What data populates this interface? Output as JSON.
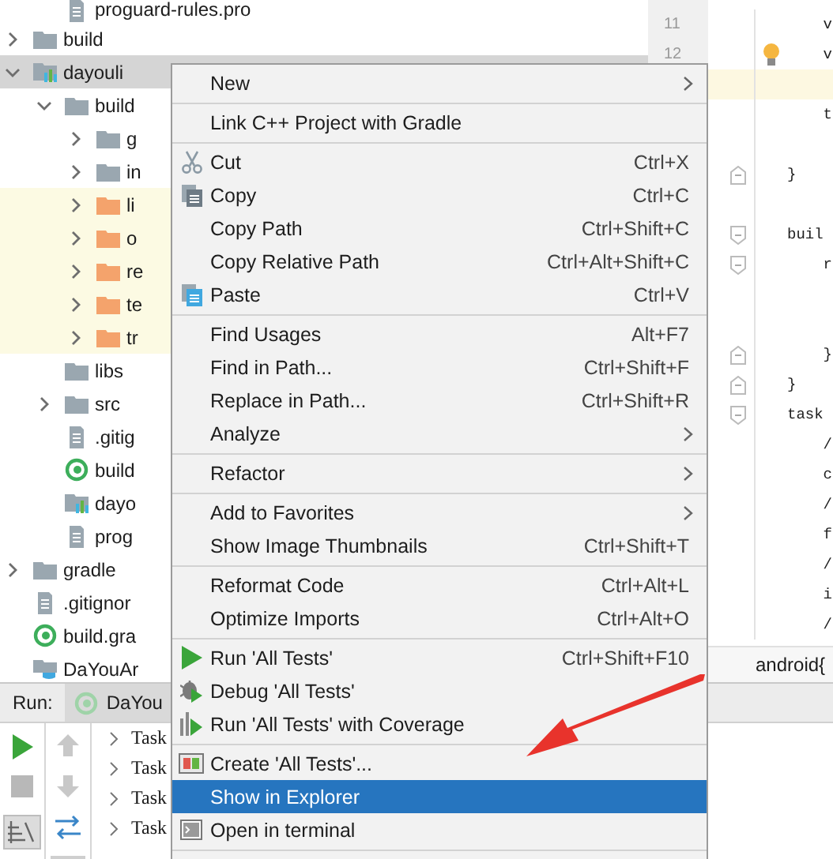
{
  "project_tree": {
    "items": [
      {
        "children": [
          {
            "label": "proguard-rules.pro",
            "kind": "file",
            "selected": false
          }
        ]
      },
      {
        "label": "build",
        "kind": "folder",
        "expanded": false,
        "selected": false
      },
      {
        "label": "dayouli",
        "kind": "module",
        "expanded": true,
        "selected": true,
        "children": [
          {
            "label": "build",
            "kind": "folder",
            "expanded": true,
            "selected": false,
            "children": [
              {
                "label": "g",
                "kind": "folder",
                "expanded": false,
                "selected": false
              },
              {
                "label": "in",
                "kind": "folder",
                "expanded": false,
                "selected": false
              },
              {
                "label": "li",
                "kind": "excluded-folder",
                "expanded": false,
                "selected": false
              },
              {
                "label": "o",
                "kind": "excluded-folder",
                "expanded": false,
                "selected": false
              },
              {
                "label": "re",
                "kind": "excluded-folder",
                "expanded": false,
                "selected": false
              },
              {
                "label": "te",
                "kind": "excluded-folder",
                "expanded": false,
                "selected": false
              },
              {
                "label": "tr",
                "kind": "excluded-folder",
                "expanded": false,
                "selected": false
              }
            ]
          },
          {
            "label": "libs",
            "kind": "folder",
            "selected": false
          },
          {
            "label": "src",
            "kind": "folder",
            "expanded": false,
            "selected": false
          },
          {
            "label": ".gitig",
            "kind": "file",
            "selected": false
          },
          {
            "label": "build",
            "kind": "gradle",
            "selected": false
          },
          {
            "label": "dayo",
            "kind": "module",
            "selected": false
          },
          {
            "label": "prog",
            "kind": "file",
            "selected": false
          }
        ]
      },
      {
        "label": "gradle",
        "kind": "folder",
        "expanded": false,
        "selected": false
      },
      {
        "label": ".gitignor",
        "kind": "file",
        "selected": false
      },
      {
        "label": "build.gra",
        "kind": "gradle",
        "selected": false
      },
      {
        "label": "DaYouAr",
        "kind": "project",
        "selected": false
      }
    ]
  },
  "editor": {
    "lines": [
      {
        "number": "11",
        "text": "    v",
        "highlighted": false,
        "bulb": false
      },
      {
        "number": "12",
        "text": "    v",
        "highlighted": false,
        "bulb": true
      },
      {
        "highlighted": true,
        "bulb": false
      },
      {
        "text": "    t",
        "highlighted": false,
        "bulb": false
      },
      {
        "highlighted": false,
        "bulb": false
      },
      {
        "text": "}",
        "highlighted": false,
        "bulb": false,
        "kind": "fold-end"
      },
      {
        "highlighted": false,
        "bulb": false
      },
      {
        "text": "buil",
        "highlighted": false,
        "bulb": false,
        "kind": "fold-start"
      },
      {
        "text": "    r",
        "highlighted": false,
        "bulb": false,
        "kind": "fold-start"
      },
      {
        "highlighted": false,
        "bulb": false
      },
      {
        "highlighted": false,
        "bulb": false
      },
      {
        "text": "    }",
        "highlighted": false,
        "bulb": false,
        "kind": "fold-end"
      },
      {
        "text": "}",
        "highlighted": false,
        "bulb": false,
        "kind": "fold-end"
      },
      {
        "text": "task",
        "highlighted": false,
        "bulb": false,
        "kind": "fold-start"
      },
      {
        "text": "    /",
        "highlighted": false,
        "bulb": false
      },
      {
        "text": "    c",
        "highlighted": false,
        "bulb": false
      },
      {
        "text": "    /",
        "highlighted": false,
        "bulb": false
      },
      {
        "text": "    f",
        "highlighted": false,
        "bulb": false
      },
      {
        "text": "    /",
        "highlighted": false,
        "bulb": false
      },
      {
        "text": "    i",
        "highlighted": false,
        "bulb": false
      },
      {
        "text": "    /",
        "highlighted": false,
        "bulb": false
      }
    ],
    "breadcrumb": "android{"
  },
  "run_panel": {
    "label": "Run:",
    "tabs": [
      {
        "label": "DaYou",
        "selected": true
      }
    ],
    "rows": [
      {
        "text": "Task",
        "expanded": false
      },
      {
        "text": "Task",
        "expanded": false
      },
      {
        "text": "Task",
        "expanded": false
      },
      {
        "text": "Task",
        "expanded": false
      }
    ]
  },
  "context_menu": {
    "groups": [
      [
        {
          "label": "New",
          "kind": "plain",
          "submenu": true,
          "selected": false
        }
      ],
      [
        {
          "label": "Link C++ Project with Gradle",
          "kind": "plain",
          "submenu": false,
          "selected": false
        }
      ],
      [
        {
          "label": "Cut",
          "shortcut": "Ctrl+X",
          "kind": "cut",
          "submenu": false,
          "selected": false
        },
        {
          "label": "Copy",
          "shortcut": "Ctrl+C",
          "kind": "copy",
          "submenu": false,
          "selected": false
        },
        {
          "label": "Copy Path",
          "shortcut": "Ctrl+Shift+C",
          "kind": "plain",
          "submenu": false,
          "selected": false
        },
        {
          "label": "Copy Relative Path",
          "shortcut": "Ctrl+Alt+Shift+C",
          "kind": "plain",
          "submenu": false,
          "selected": false
        },
        {
          "label": "Paste",
          "shortcut": "Ctrl+V",
          "kind": "paste",
          "submenu": false,
          "selected": false
        }
      ],
      [
        {
          "label": "Find Usages",
          "shortcut": "Alt+F7",
          "kind": "plain",
          "submenu": false,
          "selected": false
        },
        {
          "label": "Find in Path...",
          "shortcut": "Ctrl+Shift+F",
          "kind": "plain",
          "submenu": false,
          "selected": false
        },
        {
          "label": "Replace in Path...",
          "shortcut": "Ctrl+Shift+R",
          "kind": "plain",
          "submenu": false,
          "selected": false
        },
        {
          "label": "Analyze",
          "kind": "plain",
          "submenu": true,
          "selected": false
        }
      ],
      [
        {
          "label": "Refactor",
          "kind": "plain",
          "submenu": true,
          "selected": false
        }
      ],
      [
        {
          "label": "Add to Favorites",
          "kind": "plain",
          "submenu": true,
          "selected": false
        },
        {
          "label": "Show Image Thumbnails",
          "shortcut": "Ctrl+Shift+T",
          "kind": "plain",
          "submenu": false,
          "selected": false
        }
      ],
      [
        {
          "label": "Reformat Code",
          "shortcut": "Ctrl+Alt+L",
          "kind": "plain",
          "submenu": false,
          "selected": false
        },
        {
          "label": "Optimize Imports",
          "shortcut": "Ctrl+Alt+O",
          "kind": "plain",
          "submenu": false,
          "selected": false
        }
      ],
      [
        {
          "label": "Run 'All Tests'",
          "shortcut": "Ctrl+Shift+F10",
          "kind": "run",
          "submenu": false,
          "selected": false
        },
        {
          "label": "Debug 'All Tests'",
          "kind": "debug",
          "submenu": false,
          "selected": false
        },
        {
          "label": "Run 'All Tests' with Coverage",
          "kind": "coverage",
          "submenu": false,
          "selected": false
        }
      ],
      [
        {
          "label": "Create 'All Tests'...",
          "kind": "create",
          "submenu": false,
          "selected": false
        },
        {
          "label": "Show in Explorer",
          "kind": "plain",
          "submenu": false,
          "selected": true
        },
        {
          "label": "Open in terminal",
          "kind": "terminal",
          "submenu": false,
          "selected": false
        }
      ]
    ]
  }
}
